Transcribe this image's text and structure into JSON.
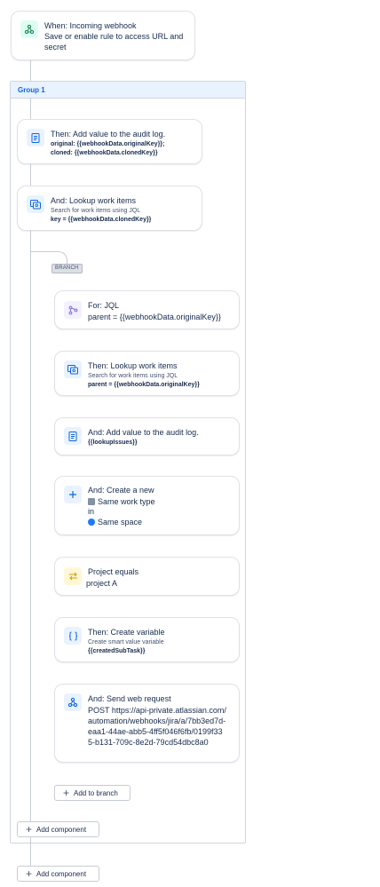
{
  "trigger": {
    "title": "When: Incoming webhook",
    "desc": "Save or enable rule to access URL and secret"
  },
  "group": {
    "title": "Group 1",
    "add_component": "Add component"
  },
  "audit_card": {
    "title": "Then: Add value to the audit log.",
    "line1": "original: {{webhookData.originalKey}};",
    "line2": "cloned: {{webhookData.clonedKey}}"
  },
  "lookup_card": {
    "title": "And: Lookup work items",
    "sub": "Search for work items using JQL",
    "bold": "key = {{webhookData.clonedKey}}"
  },
  "branch": {
    "tag": "BRANCH",
    "add_to_branch": "Add to branch",
    "for_jql": {
      "title": "For: JQL",
      "value": "parent = {{webhookData.originalKey}}"
    },
    "lookup": {
      "title": "Then: Lookup work items",
      "sub": "Search for work items using JQL",
      "bold": "parent = {{webhookData.originalKey}}"
    },
    "audit": {
      "title": "And: Add value to the audit log.",
      "bold": "{{lookupIssues}}"
    },
    "create": {
      "title": "And: Create a new",
      "type": "Same work type",
      "in": "in",
      "space": "Same space"
    },
    "condition": {
      "title": "Project equals",
      "value": "project A"
    },
    "variable": {
      "title": "Then: Create variable",
      "sub": "Create smart value variable",
      "bold": "{{createdSubTask}}"
    },
    "web_request": {
      "title": "And: Send web request",
      "value": "POST https://api-private.atlassian.com/automation/webhooks/jira/a/7bb3ed7d-eaa1-44ae-abb5-4ff5f046f6fb/0199f335-b131-709c-8e2d-79cd54dbc8a0"
    }
  },
  "footer": {
    "add_component": "Add component"
  },
  "colors": {
    "accent": "#0c66e4",
    "webhook_green": "#1f845a",
    "purple": "#8270db",
    "yellow": "#cf9f02"
  },
  "icons": {
    "trigger": "webhook-icon",
    "audit": "audit-log-icon",
    "lookup": "lookup-icon",
    "jql": "branch-jql-icon",
    "create": "plus-icon",
    "condition": "swap-arrows-icon",
    "variable": "braces-icon",
    "web_request": "webhook-icon"
  }
}
